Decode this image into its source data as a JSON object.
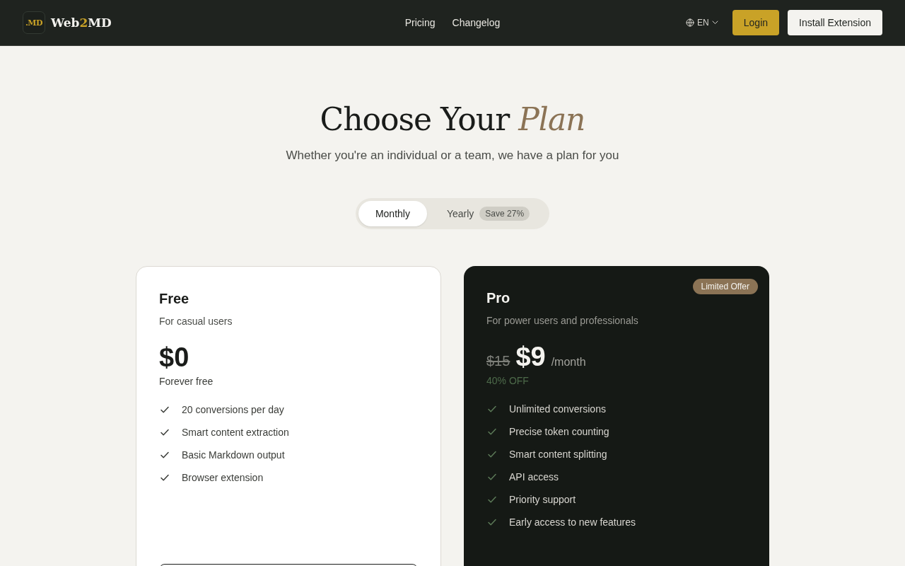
{
  "header": {
    "logo_mark": ".MD",
    "brand": {
      "start": "Web",
      "accent": "2",
      "end": "MD"
    },
    "nav": [
      {
        "label": "Pricing"
      },
      {
        "label": "Changelog"
      }
    ],
    "language": "EN",
    "login": "Login",
    "install": "Install Extension"
  },
  "hero": {
    "title": "Choose Your",
    "title_accent": "Plan",
    "subtitle": "Whether you're an individual or a team, we have a plan for you"
  },
  "billing_toggle": [
    {
      "label": "Monthly",
      "selected": true
    },
    {
      "label": "Yearly",
      "selected": false,
      "badge": "Save 27%"
    }
  ],
  "plans": [
    {
      "kind": "light",
      "name": "Free",
      "tagline": "For casual users",
      "price": "$0",
      "price_note": "Forever free",
      "features": [
        "20 conversions per day",
        "Smart content extraction",
        "Basic Markdown output",
        "Browser extension"
      ],
      "button": {
        "kind": "outline"
      }
    },
    {
      "kind": "dark",
      "name": "Pro",
      "badge": "Limited Offer",
      "tagline": "For power users and professionals",
      "old_price": "$15",
      "price": "$9",
      "period": "/month",
      "discount": "40% OFF",
      "features": [
        "Unlimited conversions",
        "Precise token counting",
        "Smart content splitting",
        "API access",
        "Priority support",
        "Early access to new features"
      ]
    }
  ]
}
